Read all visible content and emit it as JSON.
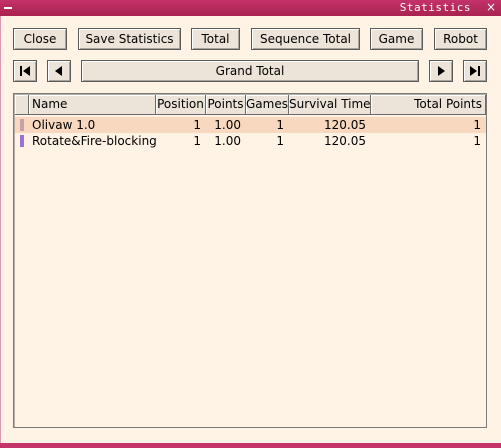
{
  "window": {
    "title": "Statistics",
    "close_glyph": "×"
  },
  "toolbar": {
    "close_label": "Close",
    "save_label": "Save Statistics",
    "total_label": "Total",
    "sequence_total_label": "Sequence Total",
    "game_label": "Game",
    "robot_label": "Robot"
  },
  "nav": {
    "first_icon": "skip-to-start-icon",
    "prev_icon": "previous-icon",
    "current_label": "Grand Total",
    "next_icon": "next-icon",
    "last_icon": "skip-to-end-icon"
  },
  "table": {
    "columns": [
      "Name",
      "Position",
      "Points",
      "Games",
      "Survival Time",
      "Total Points"
    ],
    "rows": [
      {
        "name": "Olivaw 1.0",
        "position": "1",
        "points": "1.00",
        "games": "1",
        "survival_time": "120.05",
        "total_points": "1",
        "swatch_color": "#c9a0a8",
        "row_bg": "#f8d8bf"
      },
      {
        "name": "Rotate&Fire-blocking",
        "position": "1",
        "points": "1.00",
        "games": "1",
        "survival_time": "120.05",
        "total_points": "1",
        "swatch_color": "#9a72d6",
        "row_bg": "#fff3e6"
      }
    ]
  },
  "colors": {
    "titlebar": "#c4336a",
    "background": "#fff3e6",
    "button": "#ece4d9",
    "selected_row": "#f8d8bf"
  }
}
